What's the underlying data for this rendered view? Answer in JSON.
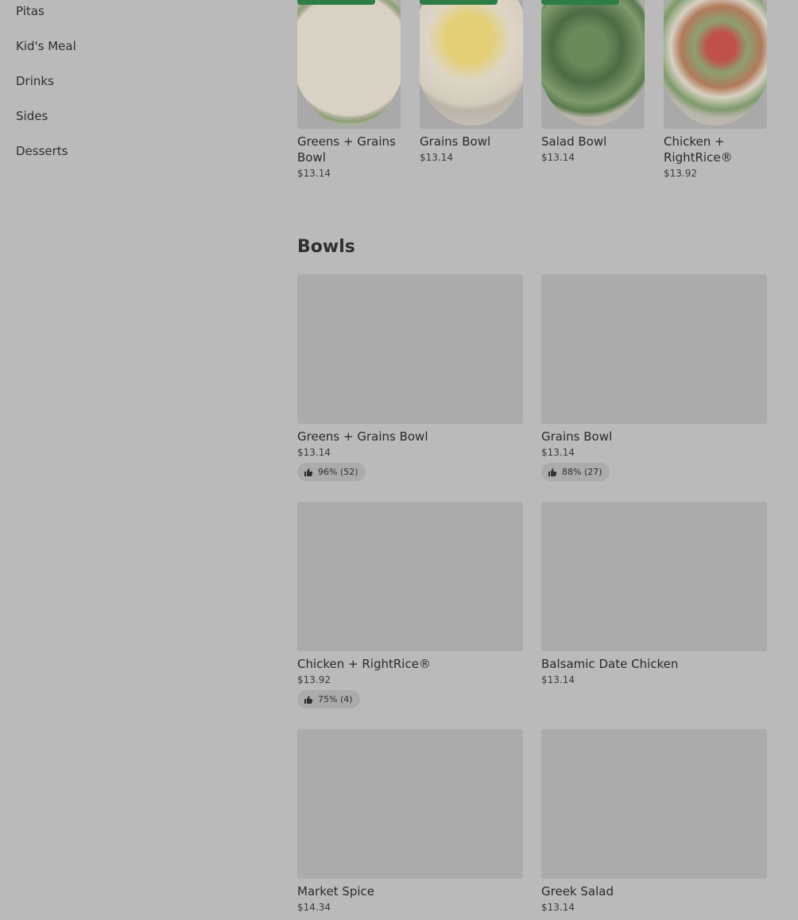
{
  "sidebar": {
    "items": [
      {
        "label": "Pitas"
      },
      {
        "label": "Kid's Meal"
      },
      {
        "label": "Drinks"
      },
      {
        "label": "Sides"
      },
      {
        "label": "Desserts"
      }
    ]
  },
  "featured": {
    "items": [
      {
        "name": "Greens + Grains Bowl",
        "price": "$13.14",
        "image": "rice-greens-bowl-photo",
        "badge_color": "#2e7d46"
      },
      {
        "name": "Grains Bowl",
        "price": "$13.14",
        "image": "yellow-rice-bowl-photo",
        "badge_color": "#2e7d46"
      },
      {
        "name": "Salad Bowl",
        "price": "$13.14",
        "image": "kale-salad-bowl-photo",
        "badge_color": "#2e7d46"
      },
      {
        "name": "Chicken + RightRice®",
        "price": "$13.92",
        "image": "chicken-veggie-bowl-photo"
      }
    ]
  },
  "bowls": {
    "title": "Bowls",
    "items": [
      {
        "name": "Greens + Grains Bowl",
        "price": "$13.14",
        "rating": "96% (52)",
        "rating_icon": "thumbs-up-icon"
      },
      {
        "name": "Grains Bowl",
        "price": "$13.14",
        "rating": "88% (27)",
        "rating_icon": "thumbs-up-icon"
      },
      {
        "name": "Chicken + RightRice®",
        "price": "$13.92",
        "rating": "75% (4)",
        "rating_icon": "thumbs-up-icon"
      },
      {
        "name": "Balsamic Date Chicken",
        "price": "$13.14"
      },
      {
        "name": "Market Spice",
        "price": "$14.34"
      },
      {
        "name": "Greek Salad",
        "price": "$13.14"
      }
    ]
  },
  "colors": {
    "overlay_background": "#bababa",
    "placeholder": "#ababab",
    "badge_green": "#2e7d46"
  }
}
